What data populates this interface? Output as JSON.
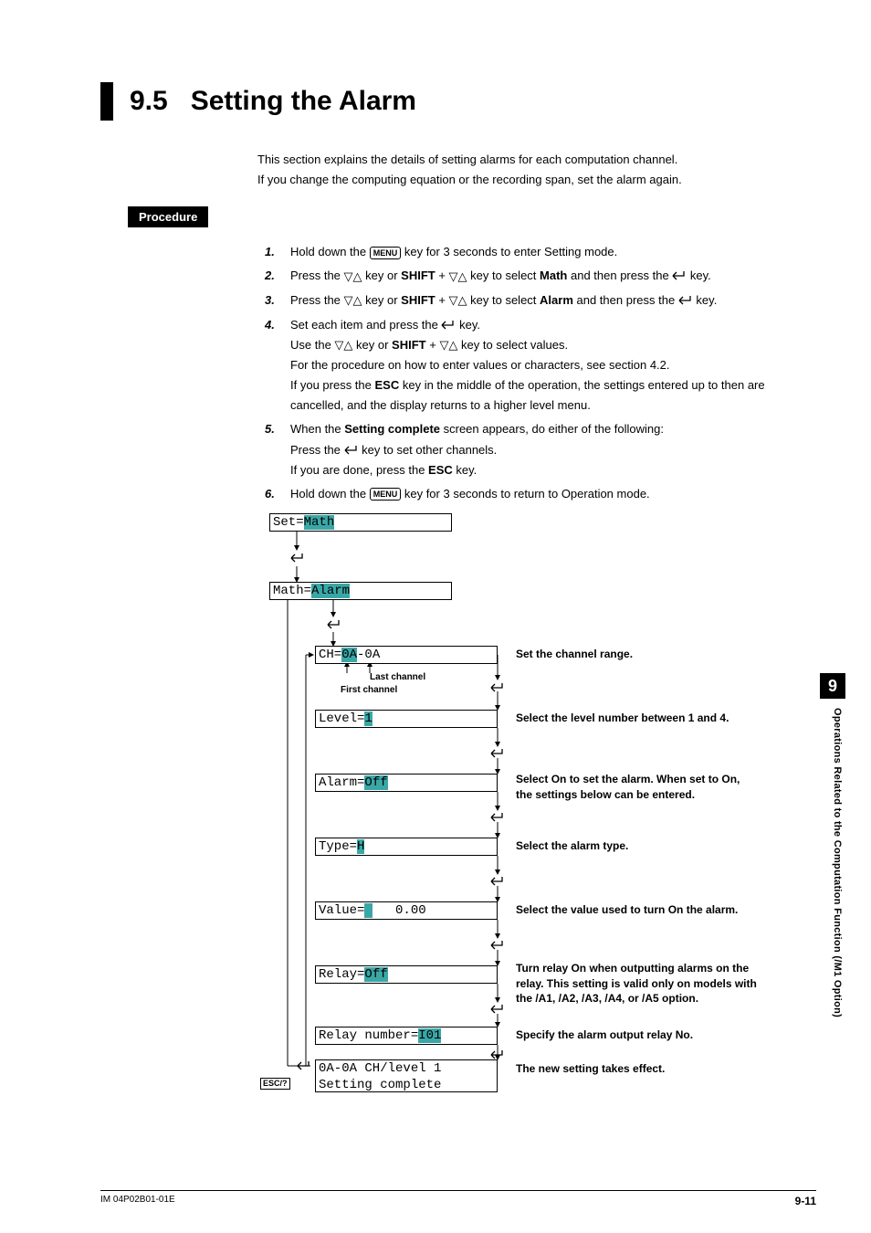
{
  "section_number": "9.5",
  "section_title": "Setting the Alarm",
  "intro_line1": "This section explains the details of setting alarms for each computation channel.",
  "intro_line2": "If you change the computing equation or the recording span, set the alarm again.",
  "procedure_label": "Procedure",
  "menu_key": "MENU",
  "shift_key": "SHIFT",
  "esc_key": "ESC",
  "steps": [
    {
      "n": "1.",
      "body_pre": "Hold down the ",
      "body_post": " key for 3 seconds to enter Setting mode."
    },
    {
      "n": "2.",
      "body": "Press the ▽△ key or SHIFT + ▽△ key to select Math and then press the ↵ key."
    },
    {
      "n": "3.",
      "body": "Press the ▽△ key or SHIFT + ▽△ key to select Alarm and then press the ↵ key."
    },
    {
      "n": "4.",
      "l1": "Set each item and press the ↵ key.",
      "l2": "Use the ▽△ key or SHIFT + ▽△ key to select values.",
      "l3": "For the procedure on how to enter values or characters, see section 4.2.",
      "l4": "If you press the ESC key in the middle of the operation, the settings entered up to then are cancelled, and the display returns to a higher level menu."
    },
    {
      "n": "5.",
      "l1": "When the Setting complete screen appears, do either of the following:",
      "l2": "Press the ↵ key to set other channels.",
      "l3": "If you are done, press the ESC key."
    },
    {
      "n": "6.",
      "body_pre": "Hold down the ",
      "body_post": " key for 3 seconds to return to Operation mode."
    }
  ],
  "lcd": {
    "set": {
      "pre": "Set=",
      "hl": "Math"
    },
    "math": {
      "pre": "Math=",
      "hl": "Alarm"
    },
    "ch": {
      "pre": "CH=",
      "hl": "0A",
      "mid": "-0A"
    },
    "level": {
      "pre": "Level=",
      "hl": "1"
    },
    "alarm": {
      "pre": "Alarm=",
      "hl": "Off"
    },
    "type": {
      "pre": "Type=",
      "hl": "H"
    },
    "value": {
      "pre": "Value=",
      "hl": " ",
      "post": "   0.00"
    },
    "relay": {
      "pre": "Relay=",
      "hl": "Off"
    },
    "relaynum": {
      "pre": "Relay number=",
      "hl": "I01"
    },
    "complete_l1": "0A-0A CH/level 1",
    "complete_l2": "Setting complete"
  },
  "captions": {
    "ch": "Set the channel range.",
    "level": "Select the level number between 1 and 4.",
    "alarm": "Select On to set the alarm.  When set to On, the settings below can be entered.",
    "type": "Select the alarm type.",
    "value": "Select the value used to turn On the alarm.",
    "relay": "Turn relay On when outputting alarms on the relay. This setting is valid only on models with the /A1, /A2, /A3, /A4, or /A5 option.",
    "relaynum": "Specify the alarm output relay No.",
    "complete": "The new setting takes effect."
  },
  "mini": {
    "last": "Last channel",
    "first": "First channel"
  },
  "escq": "ESC/?",
  "side_chapter": "9",
  "side_text": "Operations Related to the Computation Function (/M1 Option)",
  "footer_left": "IM 04P02B01-01E",
  "footer_right": "9-11"
}
